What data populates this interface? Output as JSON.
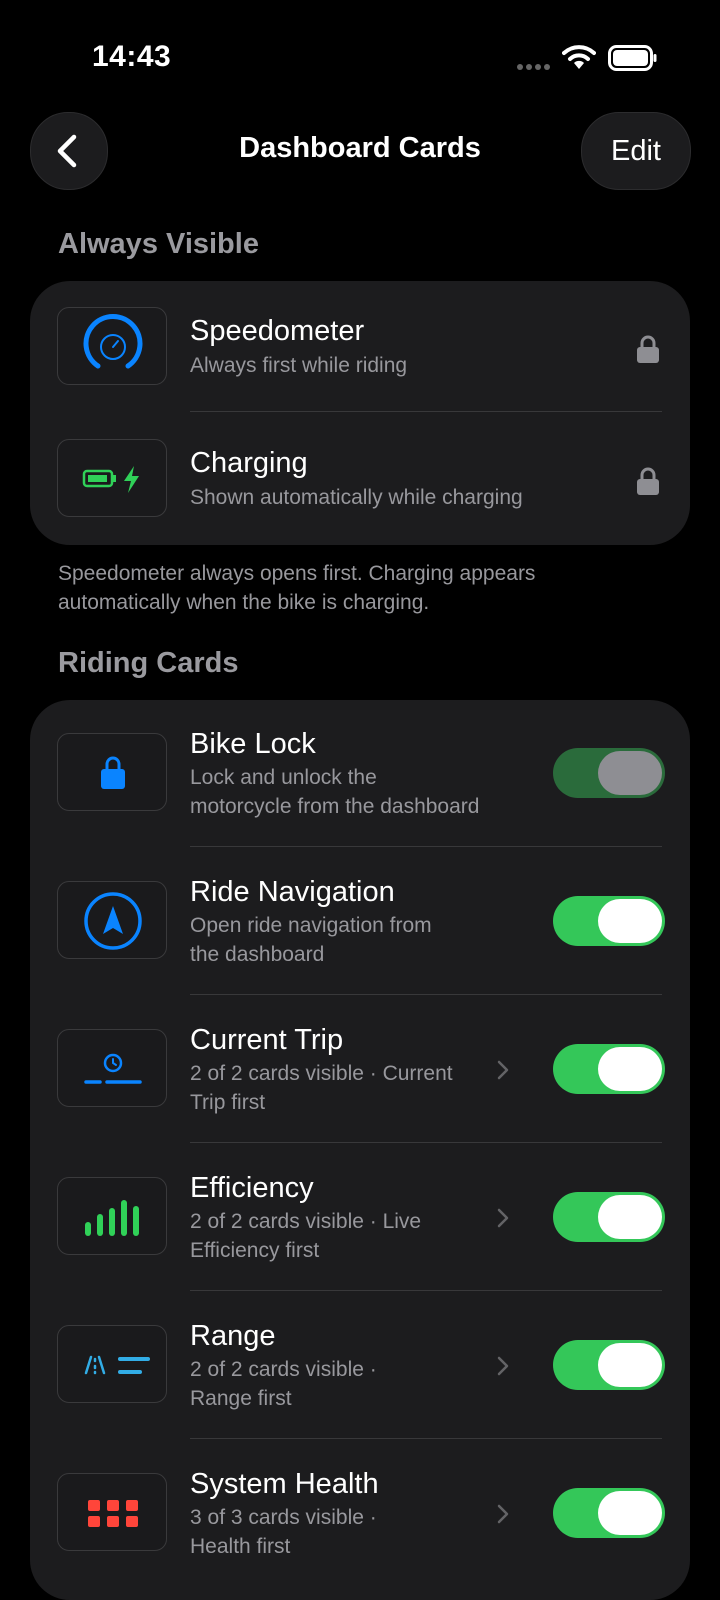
{
  "status_bar": {
    "time": "14:43"
  },
  "nav": {
    "title": "Dashboard Cards",
    "edit_label": "Edit",
    "back_icon": "chevron-left-icon"
  },
  "always_visible": {
    "header": "Always Visible",
    "items": [
      {
        "title": "Speedometer",
        "subtitle": "Always first while riding",
        "icon": "speedometer-icon",
        "locked": true
      },
      {
        "title": "Charging",
        "subtitle": "Shown automatically while charging",
        "icon": "battery-charging-icon",
        "locked": true
      }
    ],
    "note": "Speedometer always opens first. Charging appears automatically when the bike is charging."
  },
  "riding_cards": {
    "header": "Riding Cards",
    "items": [
      {
        "title": "Bike Lock",
        "subtitle_1": "Lock and unlock the",
        "subtitle_2": "motorcycle from the dashboard",
        "icon": "padlock-icon",
        "enabled": true,
        "disabled_control": true,
        "has_detail": false
      },
      {
        "title": "Ride Navigation",
        "subtitle_1": "Open ride navigation from",
        "subtitle_2": "the dashboard",
        "icon": "navigation-arrow-icon",
        "enabled": true,
        "has_detail": false
      },
      {
        "title": "Current Trip",
        "subtitle_1": "2 of 2 cards visible · Current",
        "subtitle_2": "Trip first",
        "icon": "trip-icon",
        "enabled": true,
        "has_detail": true
      },
      {
        "title": "Efficiency",
        "subtitle_1": "2 of 2 cards visible · Live",
        "subtitle_2": "Efficiency first",
        "icon": "efficiency-bars-icon",
        "enabled": true,
        "has_detail": true
      },
      {
        "title": "Range",
        "subtitle_1": "2 of 2 cards visible ·",
        "subtitle_2": "Range first",
        "icon": "range-road-icon",
        "enabled": true,
        "has_detail": true
      },
      {
        "title": "System Health",
        "subtitle_1": "3 of 3 cards visible ·",
        "subtitle_2": "Health first",
        "icon": "grid-icon",
        "enabled": true,
        "has_detail": true
      }
    ]
  },
  "colors": {
    "accent_blue": "#0a84ff",
    "accent_green": "#34c759",
    "health_red": "#ff453a",
    "range_cyan": "#32ade6"
  }
}
